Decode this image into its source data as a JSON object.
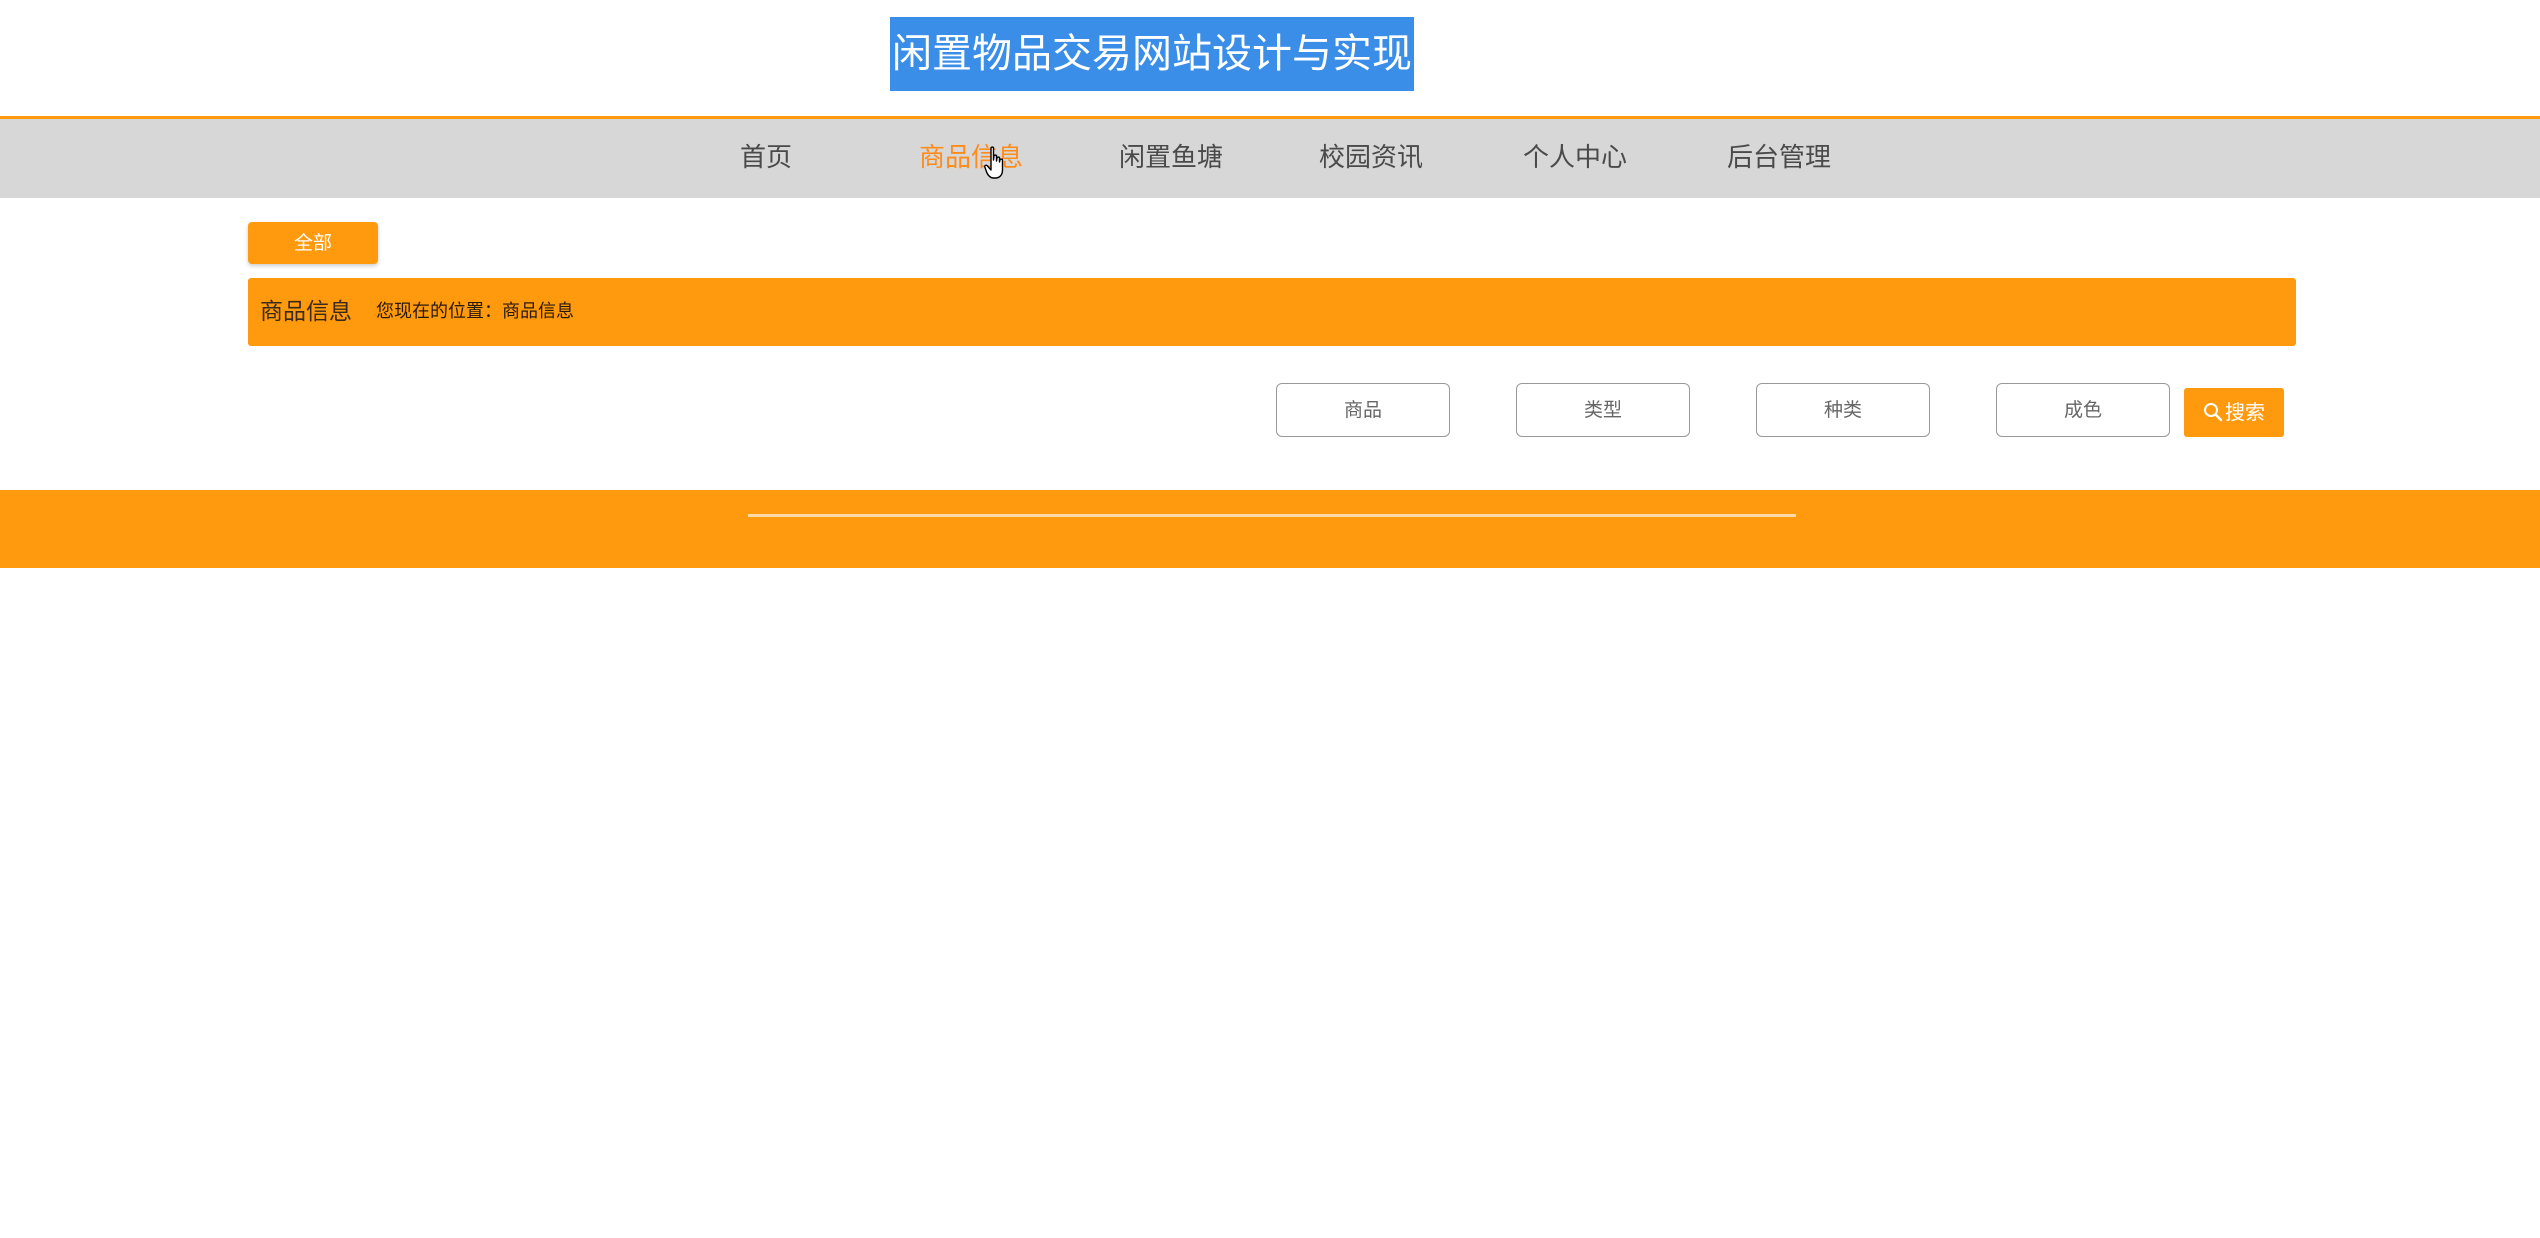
{
  "header": {
    "site_title": "闲置物品交易网站设计与实现"
  },
  "nav": {
    "items": [
      {
        "label": "首页"
      },
      {
        "label": "商品信息"
      },
      {
        "label": "闲置鱼塘"
      },
      {
        "label": "校园资讯"
      },
      {
        "label": "个人中心"
      },
      {
        "label": "后台管理"
      }
    ],
    "active_index": 1
  },
  "category": {
    "all_label": "全部"
  },
  "breadcrumb": {
    "title": "商品信息",
    "position": "您现在的位置：商品信息"
  },
  "filters": {
    "product_placeholder": "商品",
    "type_placeholder": "类型",
    "kind_placeholder": "种类",
    "condition_placeholder": "成色",
    "search_label": "搜索"
  },
  "icons": {
    "search": "search-icon",
    "cursor": "hand-pointer-icon"
  },
  "colors": {
    "accent": "#ff9a0e",
    "nav_bg": "#d7d7d7",
    "title_highlight": "#3a8ee8",
    "nav_active": "#ff8c1a"
  }
}
